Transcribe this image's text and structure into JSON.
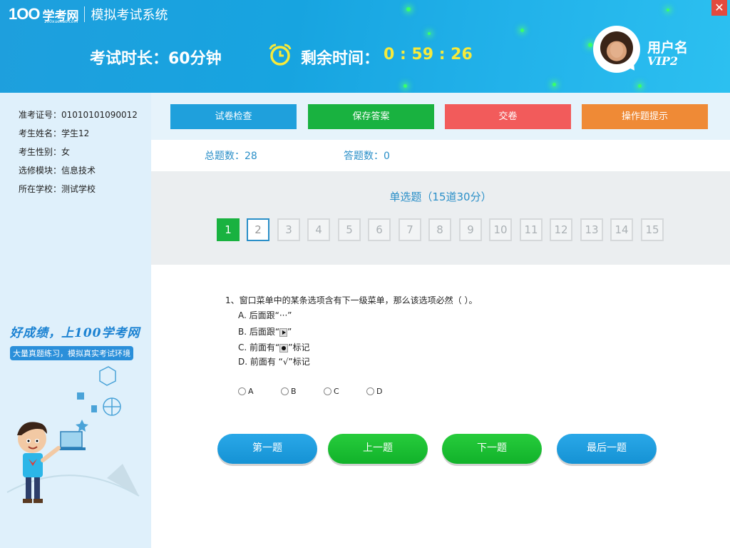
{
  "header": {
    "logo_mark": "1OO",
    "logo_brand": "学考网",
    "logo_sub": "100xuekao.com",
    "app_title": "模拟考试系统",
    "close_glyph": "✕",
    "exam_duration": "考试时长：60分钟",
    "remaining_label": "剩余时间：",
    "remaining_time": "0 : 59 : 26",
    "username": "用户名",
    "vip": "VIP2",
    "icons": {
      "clock": "alarm-clock-icon",
      "close": "close-icon"
    },
    "colors": {
      "time": "#f7ea3a",
      "close": "#e24a3e"
    }
  },
  "student": {
    "rows": [
      {
        "label": "准考证号：",
        "value": "01010101090012"
      },
      {
        "label": "考生姓名：",
        "value": "学生12"
      },
      {
        "label": "考生性别：",
        "value": "女"
      },
      {
        "label": "选修模块：",
        "value": "信息技术"
      },
      {
        "label": "所在学校：",
        "value": "测试学校"
      }
    ]
  },
  "promo": {
    "slogan": "好成绩，上100学考网",
    "sub": "大量真题练习，模拟真实考试环境"
  },
  "toolbar": {
    "check": "试卷检查",
    "save": "保存答案",
    "submit": "交卷",
    "hint": "操作题提示",
    "colors": {
      "check": "#1fa0dc",
      "save": "#19b240",
      "submit": "#f25b5b",
      "hint": "#ef8a36"
    }
  },
  "counts": {
    "total_label": "总题数：",
    "total": "28",
    "answered_label": "答题数：",
    "answered": "0"
  },
  "section": {
    "title": "单选题（15道30分）",
    "numbers": [
      "1",
      "2",
      "3",
      "4",
      "5",
      "6",
      "7",
      "8",
      "9",
      "10",
      "11",
      "12",
      "13",
      "14",
      "15"
    ],
    "current": "1",
    "selected": "2"
  },
  "question": {
    "stem": "1、窗口菜单中的某条选项含有下一级菜单，那么该选项必然（      ）。",
    "options": [
      {
        "prefix": "A.  后面跟“···”",
        "suffix": ""
      },
      {
        "prefix": "B.  后面跟“",
        "suffix": "”"
      },
      {
        "prefix": "C.  前面有“",
        "suffix": "”标记"
      },
      {
        "prefix": "D.  前面有  “√”标记",
        "suffix": ""
      }
    ],
    "choices": [
      "A",
      "B",
      "C",
      "D"
    ]
  },
  "navigation": {
    "first": "第一题",
    "prev": "上一题",
    "next": "下一题",
    "last": "最后一题"
  }
}
